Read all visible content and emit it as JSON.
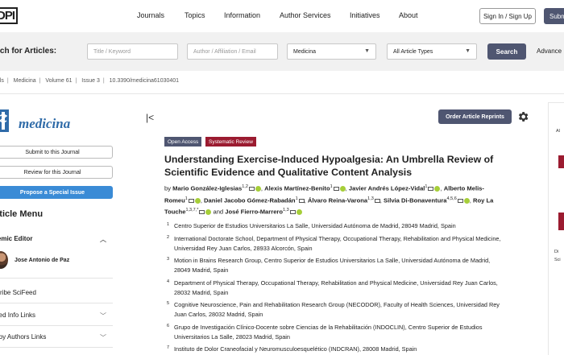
{
  "header": {
    "logo": "DPI",
    "nav": [
      "Journals",
      "Topics",
      "Information",
      "Author Services",
      "Initiatives",
      "About"
    ],
    "sign_in": "Sign In / Sign Up",
    "submit": "Subm"
  },
  "search": {
    "title": "rch for Articles:",
    "title_placeholder": "Title / Keyword",
    "author_placeholder": "Author / Affiliation / Email",
    "journal_value": "Medicina",
    "type_value": "All Article Types",
    "search_button": "Search",
    "advanced": "Advance"
  },
  "breadcrumb": [
    "nals",
    "Medicina",
    "Volume 61",
    "Issue 3",
    "10.3390/medicina61030401"
  ],
  "sidebar": {
    "journal_name": "medicina",
    "submit_btn": "Submit to this Journal",
    "review_btn": "Review for this Journal",
    "special_issue_btn": "Propose a Special Issue",
    "menu_title": "rticle Menu",
    "academic_editor_label": "demic Editor",
    "editor_name": "Jose Antonio de Paz",
    "items": [
      "scribe SciFeed",
      "ated Info Links",
      "e by Authors Links"
    ]
  },
  "main": {
    "reprints_button": "Order Article Reprints",
    "badges": [
      "Open Access",
      "Systematic Review"
    ],
    "title": "Understanding Exercise-Induced Hypoalgesia: An Umbrella Review of Scientific Evidence and Qualitative Content Analysis",
    "authors_by": "by",
    "authors": [
      {
        "name": "Mario González-Iglesias",
        "aff": "1,2"
      },
      {
        "name": "Alexis Martínez-Benito",
        "aff": "1"
      },
      {
        "name": "Javier Andrés López-Vidal",
        "aff": "1"
      },
      {
        "name": "Alberto Melis-Romeu",
        "aff": "1"
      },
      {
        "name": "Daniel Jacobo Gómez-Rabadán",
        "aff": "1"
      },
      {
        "name": "Álvaro Reina-Varona",
        "aff": "1,3"
      },
      {
        "name": "Silvia Di-Bonaventura",
        "aff": "4,5,6"
      },
      {
        "name": "Roy La Touche",
        "aff": "1,3,7,*"
      },
      {
        "name": "José Fierro-Marrero",
        "aff": "1,3"
      }
    ],
    "and": "and",
    "affiliations": [
      {
        "n": "1",
        "text": "Centro Superior de Estudios Universitarios La Salle, Universidad Autónoma de Madrid, 28049 Madrid, Spain"
      },
      {
        "n": "2",
        "text": "International Doctorate School, Department of Physical Therapy, Occupational Therapy, Rehabilitation and Physical Medicine, Universidad Rey Juan Carlos, 28933 Alcorcón, Spain"
      },
      {
        "n": "3",
        "text": "Motion in Brains Research Group, Centro Superior de Estudios Universitarios La Salle, Universidad Autónoma de Madrid, 28049 Madrid, Spain"
      },
      {
        "n": "4",
        "text": "Department of Physical Therapy, Occupational Therapy, Rehabilitation and Physical Medicine, Universidad Rey Juan Carlos, 28032 Madrid, Spain"
      },
      {
        "n": "5",
        "text": "Cognitive Neuroscience, Pain and Rehabilitation Research Group (NECODOR), Faculty of Health Sciences, Universidad Rey Juan Carlos, 28032 Madrid, Spain"
      },
      {
        "n": "6",
        "text": "Grupo de Investigación Clínico-Docente sobre Ciencias de la Rehabilitación (INDOCLIN), Centro Superior de Estudios Universitarios La Salle, 28023 Madrid, Spain"
      },
      {
        "n": "7",
        "text": "Instituto de Dolor Craneofacial y Neuromusculoesquelético (INDCRAN), 28008 Madrid, Spain"
      }
    ]
  },
  "right": {
    "text1": "Al",
    "text2": "Di",
    "text3": "Sci"
  }
}
